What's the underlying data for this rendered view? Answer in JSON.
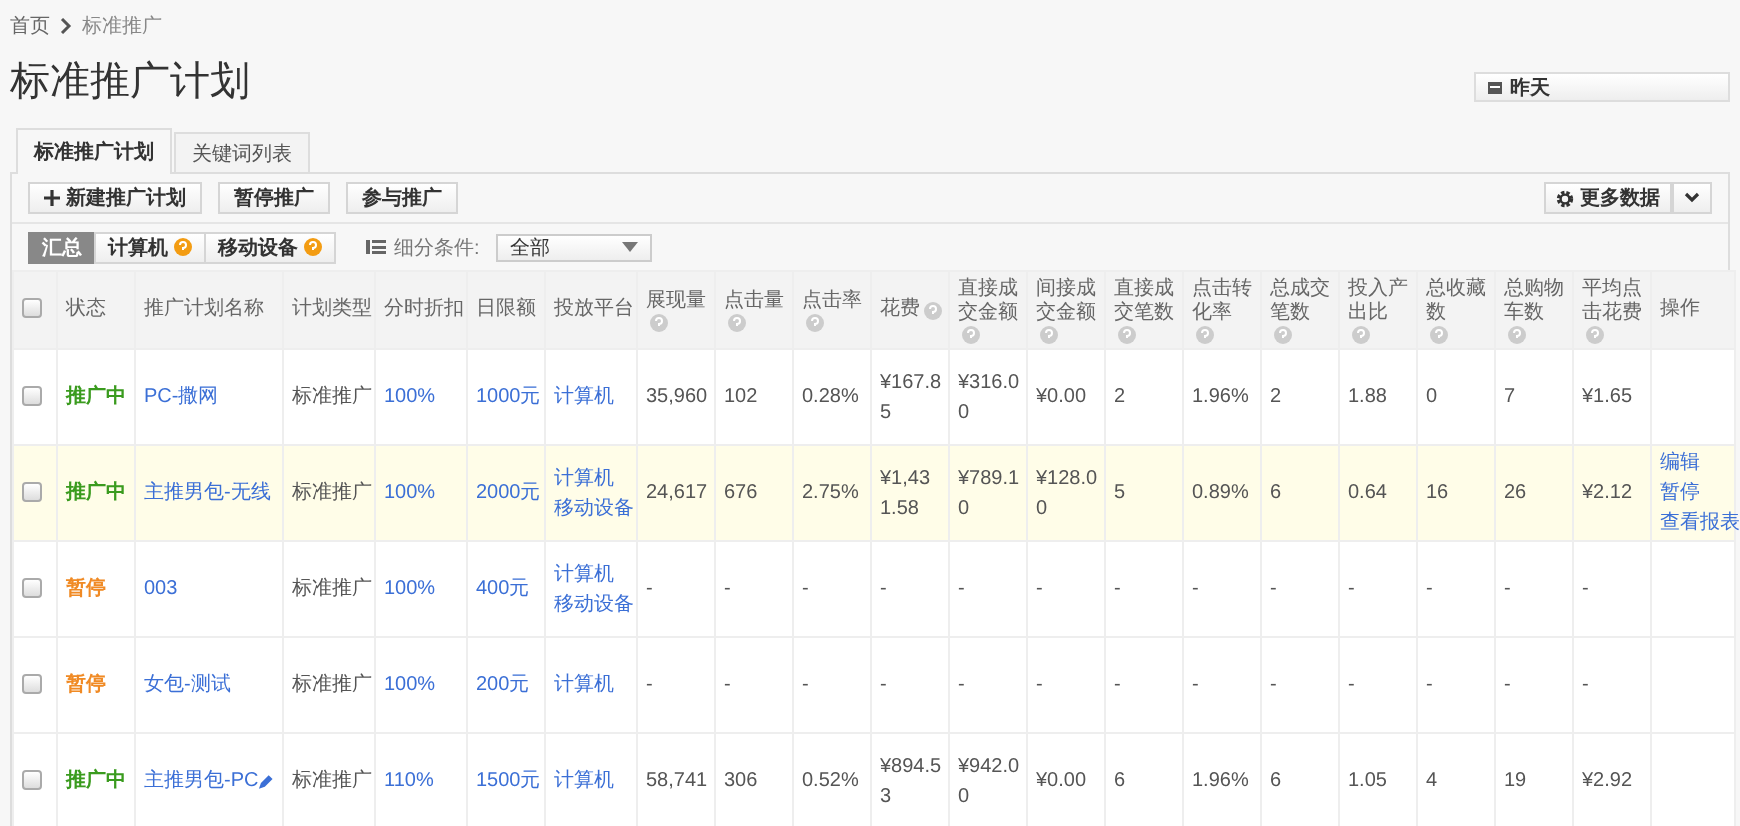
{
  "breadcrumb": [
    {
      "label": "首页"
    },
    {
      "label": "标准推广"
    }
  ],
  "title": "标准推广计划",
  "date_button": {
    "label": "昨天"
  },
  "tabs": [
    {
      "label": "标准推广计划",
      "selected": true
    },
    {
      "label": "关键词列表",
      "selected": false
    }
  ],
  "toolbar": {
    "buttons": [
      {
        "label": "新建推广计划",
        "kind": "add"
      },
      {
        "label": "暂停推广",
        "kind": "plain"
      },
      {
        "label": "参与推广",
        "kind": "plain"
      }
    ],
    "more_button": {
      "label": "更多数据"
    }
  },
  "filter": {
    "segments": [
      {
        "label": "汇总",
        "selected": true,
        "warning": false
      },
      {
        "label": "计算机",
        "selected": false,
        "warning": true
      },
      {
        "label": "移动设备",
        "selected": false,
        "warning": true
      }
    ],
    "condition_label": "细分条件:",
    "condition_value": "全部"
  },
  "table": {
    "header_checkbox": {
      "checked": false
    },
    "columns": [
      {
        "label": "状态",
        "help": false
      },
      {
        "label": "推广计划名称",
        "help": false
      },
      {
        "label": "计划类型",
        "help": false
      },
      {
        "label": "分时折扣",
        "help": false
      },
      {
        "label": "日限额",
        "help": false
      },
      {
        "label": "投放平台",
        "help": false
      },
      {
        "label": "展现量",
        "help": true
      },
      {
        "label": "点击量",
        "help": true
      },
      {
        "label": "点击率",
        "help": true
      },
      {
        "label": "花费",
        "help": true
      },
      {
        "label": "直接成交金额",
        "help": true
      },
      {
        "label": "间接成交金额",
        "help": true
      },
      {
        "label": "直接成交笔数",
        "help": true
      },
      {
        "label": "点击转化率",
        "help": true
      },
      {
        "label": "总成交笔数",
        "help": true
      },
      {
        "label": "投入产出比",
        "help": true
      },
      {
        "label": "总收藏数",
        "help": true
      },
      {
        "label": "总购物车数",
        "help": true
      },
      {
        "label": "平均点击花费",
        "help": true
      },
      {
        "label": "操作",
        "help": false
      }
    ],
    "rows": [
      {
        "checked": false,
        "highlighted": false,
        "status": "推广中",
        "color": "#3a9b1e",
        "name": "PC-撒网",
        "name_editable": false,
        "type": "标准推广",
        "discount": "100%",
        "limit": "1000元",
        "platforms": [
          "计算机"
        ],
        "metrics": [
          "35,960",
          "102",
          "0.28%",
          "¥167.85",
          "¥316.00",
          "¥0.00",
          "2",
          "1.96%",
          "2",
          "1.88",
          "0",
          "7",
          "¥1.65"
        ]
      },
      {
        "checked": false,
        "highlighted": true,
        "status": "推广中",
        "color": "#3a9b1e",
        "name": "主推男包-无线",
        "name_editable": false,
        "type": "标准推广",
        "discount": "100%",
        "limit": "2000元",
        "platforms": [
          "计算机",
          "移动设备"
        ],
        "metrics": [
          "24,617",
          "676",
          "2.75%",
          "¥1,431.58",
          "¥789.10",
          "¥128.00",
          "5",
          "0.89%",
          "6",
          "0.64",
          "16",
          "26",
          "¥2.12"
        ],
        "actions": [
          "编辑",
          "暂停",
          "查看报表"
        ]
      },
      {
        "checked": false,
        "highlighted": false,
        "status": "暂停",
        "color": "#f08a24",
        "name": "003",
        "name_editable": false,
        "type": "标准推广",
        "discount": "100%",
        "limit": "400元",
        "platforms": [
          "计算机",
          "移动设备"
        ],
        "metrics": [
          "-",
          "-",
          "-",
          "-",
          "-",
          "-",
          "-",
          "-",
          "-",
          "-",
          "-",
          "-",
          "-"
        ]
      },
      {
        "checked": false,
        "highlighted": false,
        "status": "暂停",
        "color": "#f08a24",
        "name": "女包-测试",
        "name_editable": false,
        "type": "标准推广",
        "discount": "100%",
        "limit": "200元",
        "platforms": [
          "计算机"
        ],
        "metrics": [
          "-",
          "-",
          "-",
          "-",
          "-",
          "-",
          "-",
          "-",
          "-",
          "-",
          "-",
          "-",
          "-"
        ]
      },
      {
        "checked": false,
        "highlighted": false,
        "status": "推广中",
        "color": "#3a9b1e",
        "name": "主推男包-PC",
        "name_editable": true,
        "type": "标准推广",
        "discount": "110%",
        "limit": "1500元",
        "platforms": [
          "计算机"
        ],
        "metrics": [
          "58,741",
          "306",
          "0.52%",
          "¥894.53",
          "¥942.00",
          "¥0.00",
          "6",
          "1.96%",
          "6",
          "1.05",
          "4",
          "19",
          "¥2.92"
        ]
      }
    ]
  }
}
